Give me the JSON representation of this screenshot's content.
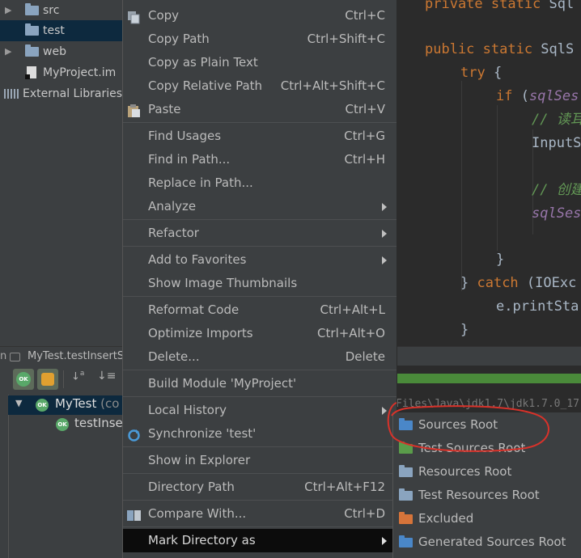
{
  "project_tree": {
    "items": [
      {
        "label": "src",
        "icon": "folder-icon"
      },
      {
        "label": "test",
        "icon": "folder-icon"
      },
      {
        "label": "web",
        "icon": "folder-icon"
      },
      {
        "label": "MyProject.im",
        "icon": "module-file-icon"
      },
      {
        "label": "External Libraries",
        "icon": "libraries-icon"
      }
    ]
  },
  "editor": {
    "lines": [
      {
        "kw": "private static ",
        "tx": "Sql"
      },
      {
        "kw": "public static ",
        "tx": "SqlS"
      },
      {
        "kw": "try ",
        "tx": "{"
      },
      {
        "kw": "if ",
        "tx": "(",
        "it": "sqlSes"
      },
      {
        "cm": "// 读耳"
      },
      {
        "tx": "InputS"
      },
      {
        "cm": "// 创建"
      },
      {
        "it": "sqlSes"
      },
      {
        "tx": "}"
      },
      {
        "tx": "} ",
        "kw": "catch ",
        "tx2": "(IOExc"
      },
      {
        "tx": "e.printSta"
      },
      {
        "tx": "}"
      }
    ]
  },
  "run_tab": {
    "label": "MyTest.testInsertS",
    "prefix": "n"
  },
  "run_tree": {
    "items": [
      {
        "label": "MyTest",
        "suffix": "(co"
      },
      {
        "label": "testInse"
      }
    ],
    "ok_badge": "OK",
    "console_text": "Files\\Java\\jdk1.7\\jdk1.7.0_17"
  },
  "context_menu": {
    "items": [
      {
        "label": "Copy",
        "shortcut": "Ctrl+C"
      },
      {
        "label": "Copy Path",
        "shortcut": "Ctrl+Shift+C"
      },
      {
        "label": "Copy as Plain Text",
        "shortcut": ""
      },
      {
        "label": "Copy Relative Path",
        "shortcut": "Ctrl+Alt+Shift+C"
      },
      {
        "label": "Paste",
        "shortcut": "Ctrl+V"
      },
      {
        "label": "Find Usages",
        "shortcut": "Ctrl+G"
      },
      {
        "label": "Find in Path...",
        "shortcut": "Ctrl+H"
      },
      {
        "label": "Replace in Path...",
        "shortcut": ""
      },
      {
        "label": "Analyze",
        "shortcut": ""
      },
      {
        "label": "Refactor",
        "shortcut": ""
      },
      {
        "label": "Add to Favorites",
        "shortcut": ""
      },
      {
        "label": "Show Image Thumbnails",
        "shortcut": ""
      },
      {
        "label": "Reformat Code",
        "shortcut": "Ctrl+Alt+L"
      },
      {
        "label": "Optimize Imports",
        "shortcut": "Ctrl+Alt+O"
      },
      {
        "label": "Delete...",
        "shortcut": "Delete"
      },
      {
        "label": "Build Module 'MyProject'",
        "shortcut": ""
      },
      {
        "label": "Local History",
        "shortcut": ""
      },
      {
        "label": "Synchronize 'test'",
        "shortcut": ""
      },
      {
        "label": "Show in Explorer",
        "shortcut": ""
      },
      {
        "label": "Directory Path",
        "shortcut": "Ctrl+Alt+F12"
      },
      {
        "label": "Compare With...",
        "shortcut": "Ctrl+D"
      },
      {
        "label": "Mark Directory as",
        "shortcut": ""
      }
    ]
  },
  "submenu": {
    "items": [
      {
        "label": "Sources Root",
        "color": "#4a87c8"
      },
      {
        "label": "Test Sources Root",
        "color": "#5a9c4a"
      },
      {
        "label": "Resources Root",
        "color": "#8aa4bf"
      },
      {
        "label": "Test Resources Root",
        "color": "#8aa4bf"
      },
      {
        "label": "Excluded",
        "color": "#d6743a"
      },
      {
        "label": "Generated Sources Root",
        "color": "#4a87c8"
      }
    ]
  },
  "colors": {
    "accent": "#0d293e",
    "annotation": "#d9322a"
  }
}
